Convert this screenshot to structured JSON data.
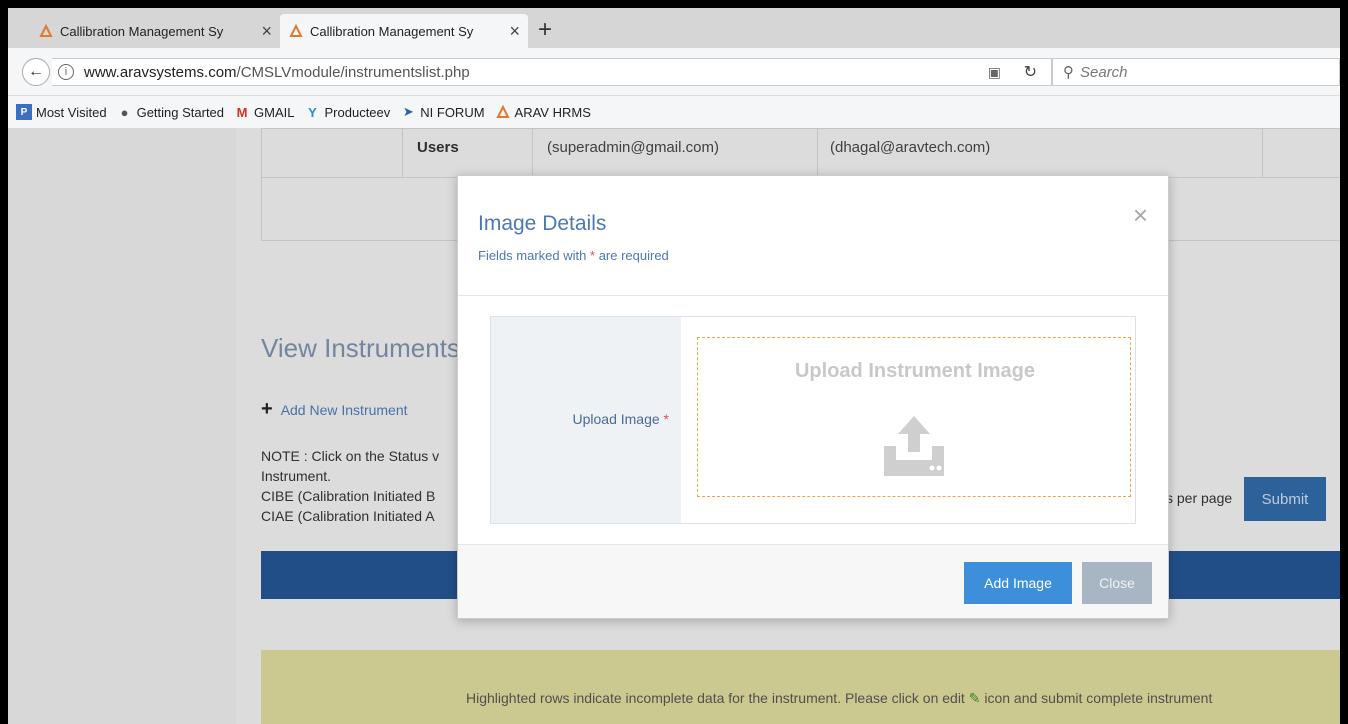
{
  "browser": {
    "tabs": [
      {
        "title": "Callibration Management Sy",
        "active": false
      },
      {
        "title": "Callibration Management Sy",
        "active": true
      }
    ],
    "url": {
      "host": "www.aravsystems.com",
      "path": "/CMSLVmodule/instrumentslist.php"
    },
    "search_placeholder": "Search",
    "bookmarks": [
      "Most Visited",
      "Getting Started",
      "GMAIL",
      "Producteev",
      "NI FORUM",
      "ARAV HRMS"
    ]
  },
  "background": {
    "table": {
      "users_label": "Users",
      "email1": "(superadmin@gmail.com)",
      "email2": "(dhagal@aravtech.com)"
    },
    "view_title": "View Instruments",
    "add_new_label": "Add New Instrument",
    "note_lines": [
      "NOTE : Click on the Status v",
      "Instrument.",
      "CIBE (Calibration Initiated B",
      "CIAE (Calibration Initiated A"
    ],
    "per_page_label": "s per page",
    "submit_label": "Submit",
    "highlight_text_before": "Highlighted rows indicate incomplete data for the instrument. Please click on edit",
    "highlight_text_after": "icon and submit complete instrument"
  },
  "modal": {
    "title": "Image Details",
    "subtitle_before": "Fields marked with",
    "required_marker": "*",
    "subtitle_after": "are required",
    "upload_label": "Upload Image",
    "dropzone_title": "Upload Instrument Image",
    "add_button": "Add Image",
    "close_button": "Close",
    "close_icon": "×"
  },
  "colors": {
    "accent": "#4b79b0",
    "primary_button": "#3c8fd8",
    "dropzone_border": "#f0a545",
    "required": "#d9534f"
  }
}
